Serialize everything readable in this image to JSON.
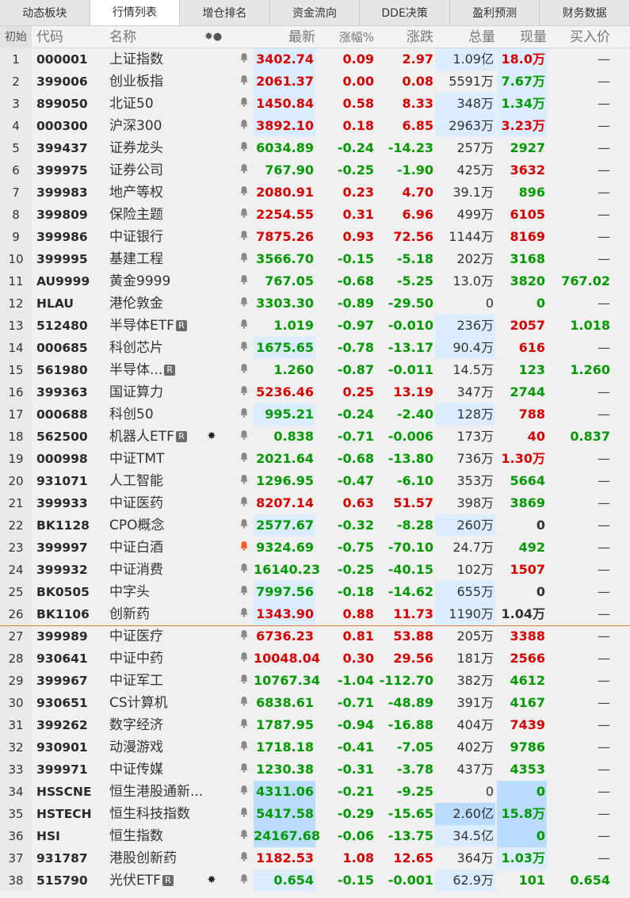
{
  "tabs": [
    "动态板块",
    "行情列表",
    "增仓排名",
    "资金流向",
    "DDE决策",
    "盈利预测",
    "财务数据"
  ],
  "active_tab": 1,
  "header": {
    "idx": "初始",
    "code": "代码",
    "name": "名称",
    "flags": "✸●",
    "last": "最新",
    "pct": "涨幅%",
    "chg": "涨跌",
    "vol": "总量",
    "cur": "现量",
    "bid": "买入价"
  },
  "colors": {
    "up": "#d60000",
    "down": "#009a00",
    "highlight": "#dcecff",
    "highlight_strong": "#b9dcff",
    "separator": "#e07a3a"
  },
  "rows": [
    {
      "i": "1",
      "code": "000001",
      "name": "上证指数",
      "badge": "",
      "flag": "",
      "bell": "off",
      "last": "3402.74",
      "lastHl": "hl1",
      "pct": "0.09",
      "chg": "2.97",
      "vol": "1.09亿",
      "volHl": "hl1",
      "cur": "18.0万",
      "curHl": "hl1",
      "bid": "—",
      "dir": "up",
      "curDir": "up",
      "bidDir": ""
    },
    {
      "i": "2",
      "code": "399006",
      "name": "创业板指",
      "badge": "",
      "flag": "",
      "bell": "off",
      "last": "2061.37",
      "lastHl": "hl1",
      "pct": "0.00",
      "chg": "0.08",
      "vol": "5591万",
      "volHl": "",
      "cur": "7.67万",
      "curHl": "hl1",
      "bid": "—",
      "dir": "up",
      "curDir": "dn",
      "bidDir": ""
    },
    {
      "i": "3",
      "code": "899050",
      "name": "北证50",
      "badge": "",
      "flag": "",
      "bell": "off",
      "last": "1450.84",
      "lastHl": "hl1",
      "pct": "0.58",
      "chg": "8.33",
      "vol": "348万",
      "volHl": "hl1",
      "cur": "1.34万",
      "curHl": "hl1",
      "bid": "—",
      "dir": "up",
      "curDir": "dn",
      "bidDir": ""
    },
    {
      "i": "4",
      "code": "000300",
      "name": "沪深300",
      "badge": "",
      "flag": "",
      "bell": "off",
      "last": "3892.10",
      "lastHl": "hl1",
      "pct": "0.18",
      "chg": "6.85",
      "vol": "2963万",
      "volHl": "hl1",
      "cur": "3.23万",
      "curHl": "hl1",
      "bid": "—",
      "dir": "up",
      "curDir": "up",
      "bidDir": ""
    },
    {
      "i": "5",
      "code": "399437",
      "name": "证券龙头",
      "badge": "",
      "flag": "",
      "bell": "off",
      "last": "6034.89",
      "lastHl": "",
      "pct": "-0.24",
      "chg": "-14.23",
      "vol": "257万",
      "volHl": "",
      "cur": "2927",
      "curHl": "",
      "bid": "—",
      "dir": "dn",
      "curDir": "dn",
      "bidDir": ""
    },
    {
      "i": "6",
      "code": "399975",
      "name": "证券公司",
      "badge": "",
      "flag": "",
      "bell": "off",
      "last": "767.90",
      "lastHl": "",
      "pct": "-0.25",
      "chg": "-1.90",
      "vol": "425万",
      "volHl": "",
      "cur": "3632",
      "curHl": "",
      "bid": "—",
      "dir": "dn",
      "curDir": "up",
      "bidDir": ""
    },
    {
      "i": "7",
      "code": "399983",
      "name": "地产等权",
      "badge": "",
      "flag": "",
      "bell": "off",
      "last": "2080.91",
      "lastHl": "",
      "pct": "0.23",
      "chg": "4.70",
      "vol": "39.1万",
      "volHl": "",
      "cur": "896",
      "curHl": "",
      "bid": "—",
      "dir": "up",
      "curDir": "dn",
      "bidDir": ""
    },
    {
      "i": "8",
      "code": "399809",
      "name": "保险主题",
      "badge": "",
      "flag": "",
      "bell": "off",
      "last": "2254.55",
      "lastHl": "",
      "pct": "0.31",
      "chg": "6.96",
      "vol": "499万",
      "volHl": "",
      "cur": "6105",
      "curHl": "",
      "bid": "—",
      "dir": "up",
      "curDir": "up",
      "bidDir": ""
    },
    {
      "i": "9",
      "code": "399986",
      "name": "中证银行",
      "badge": "",
      "flag": "",
      "bell": "off",
      "last": "7875.26",
      "lastHl": "",
      "pct": "0.93",
      "chg": "72.56",
      "vol": "1144万",
      "volHl": "",
      "cur": "8169",
      "curHl": "",
      "bid": "—",
      "dir": "up",
      "curDir": "up",
      "bidDir": ""
    },
    {
      "i": "10",
      "code": "399995",
      "name": "基建工程",
      "badge": "",
      "flag": "",
      "bell": "off",
      "last": "3566.70",
      "lastHl": "",
      "pct": "-0.15",
      "chg": "-5.18",
      "vol": "202万",
      "volHl": "",
      "cur": "3168",
      "curHl": "",
      "bid": "—",
      "dir": "dn",
      "curDir": "dn",
      "bidDir": ""
    },
    {
      "i": "11",
      "code": "AU9999",
      "name": "黄金9999",
      "badge": "",
      "flag": "",
      "bell": "off",
      "last": "767.05",
      "lastHl": "",
      "pct": "-0.68",
      "chg": "-5.25",
      "vol": "13.0万",
      "volHl": "",
      "cur": "3820",
      "curHl": "",
      "bid": "767.02",
      "dir": "dn",
      "curDir": "dn",
      "bidDir": "dn"
    },
    {
      "i": "12",
      "code": "HLAU",
      "name": "港伦敦金",
      "badge": "",
      "flag": "",
      "bell": "off",
      "last": "3303.30",
      "lastHl": "",
      "pct": "-0.89",
      "chg": "-29.50",
      "vol": "0",
      "volHl": "",
      "cur": "0",
      "curHl": "",
      "bid": "—",
      "dir": "dn",
      "curDir": "dn",
      "bidDir": ""
    },
    {
      "i": "13",
      "code": "512480",
      "name": "半导体ETF",
      "badge": "R",
      "flag": "",
      "bell": "off",
      "last": "1.019",
      "lastHl": "",
      "pct": "-0.97",
      "chg": "-0.010",
      "vol": "236万",
      "volHl": "hl1",
      "cur": "2057",
      "curHl": "",
      "bid": "1.018",
      "dir": "dn",
      "curDir": "up",
      "bidDir": "dn"
    },
    {
      "i": "14",
      "code": "000685",
      "name": "科创芯片",
      "badge": "",
      "flag": "",
      "bell": "off",
      "last": "1675.65",
      "lastHl": "hl1",
      "pct": "-0.78",
      "chg": "-13.17",
      "vol": "90.4万",
      "volHl": "hl1",
      "cur": "616",
      "curHl": "",
      "bid": "—",
      "dir": "dn",
      "curDir": "up",
      "bidDir": ""
    },
    {
      "i": "15",
      "code": "561980",
      "name": "半导体...",
      "badge": "R",
      "flag": "",
      "bell": "off",
      "last": "1.260",
      "lastHl": "",
      "pct": "-0.87",
      "chg": "-0.011",
      "vol": "14.5万",
      "volHl": "",
      "cur": "123",
      "curHl": "",
      "bid": "1.260",
      "dir": "dn",
      "curDir": "dn",
      "bidDir": "dn"
    },
    {
      "i": "16",
      "code": "399363",
      "name": "国证算力",
      "badge": "",
      "flag": "",
      "bell": "off",
      "last": "5236.46",
      "lastHl": "",
      "pct": "0.25",
      "chg": "13.19",
      "vol": "347万",
      "volHl": "",
      "cur": "2744",
      "curHl": "",
      "bid": "—",
      "dir": "up",
      "curDir": "dn",
      "bidDir": ""
    },
    {
      "i": "17",
      "code": "000688",
      "name": "科创50",
      "badge": "",
      "flag": "",
      "bell": "off",
      "last": "995.21",
      "lastHl": "hl1",
      "pct": "-0.24",
      "chg": "-2.40",
      "vol": "128万",
      "volHl": "hl1",
      "cur": "788",
      "curHl": "",
      "bid": "—",
      "dir": "dn",
      "curDir": "up",
      "bidDir": ""
    },
    {
      "i": "18",
      "code": "562500",
      "name": "机器人ETF",
      "badge": "R",
      "flag": "✸",
      "bell": "off",
      "last": "0.838",
      "lastHl": "",
      "pct": "-0.71",
      "chg": "-0.006",
      "vol": "173万",
      "volHl": "",
      "cur": "40",
      "curHl": "",
      "bid": "0.837",
      "dir": "dn",
      "curDir": "up",
      "bidDir": "dn"
    },
    {
      "i": "19",
      "code": "000998",
      "name": "中证TMT",
      "badge": "",
      "flag": "",
      "bell": "off",
      "last": "2021.64",
      "lastHl": "",
      "pct": "-0.68",
      "chg": "-13.80",
      "vol": "736万",
      "volHl": "",
      "cur": "1.30万",
      "curHl": "",
      "bid": "—",
      "dir": "dn",
      "curDir": "up",
      "bidDir": ""
    },
    {
      "i": "20",
      "code": "931071",
      "name": "人工智能",
      "badge": "",
      "flag": "",
      "bell": "off",
      "last": "1296.95",
      "lastHl": "",
      "pct": "-0.47",
      "chg": "-6.10",
      "vol": "353万",
      "volHl": "",
      "cur": "5664",
      "curHl": "",
      "bid": "—",
      "dir": "dn",
      "curDir": "dn",
      "bidDir": ""
    },
    {
      "i": "21",
      "code": "399933",
      "name": "中证医药",
      "badge": "",
      "flag": "",
      "bell": "off",
      "last": "8207.14",
      "lastHl": "",
      "pct": "0.63",
      "chg": "51.57",
      "vol": "398万",
      "volHl": "",
      "cur": "3869",
      "curHl": "",
      "bid": "—",
      "dir": "up",
      "curDir": "dn",
      "bidDir": ""
    },
    {
      "i": "22",
      "code": "BK1128",
      "name": "CPO概念",
      "badge": "",
      "flag": "",
      "bell": "off",
      "last": "2577.67",
      "lastHl": "hl1",
      "pct": "-0.32",
      "chg": "-8.28",
      "vol": "260万",
      "volHl": "hl1",
      "cur": "0",
      "curHl": "",
      "bid": "—",
      "dir": "dn",
      "curDir": "zr",
      "bidDir": ""
    },
    {
      "i": "23",
      "code": "399997",
      "name": "中证白酒",
      "badge": "",
      "flag": "",
      "bell": "on",
      "last": "9324.69",
      "lastHl": "",
      "pct": "-0.75",
      "chg": "-70.10",
      "vol": "24.7万",
      "volHl": "",
      "cur": "492",
      "curHl": "",
      "bid": "—",
      "dir": "dn",
      "curDir": "dn",
      "bidDir": ""
    },
    {
      "i": "24",
      "code": "399932",
      "name": "中证消费",
      "badge": "",
      "flag": "",
      "bell": "off",
      "last": "16140.23",
      "lastHl": "",
      "pct": "-0.25",
      "chg": "-40.15",
      "vol": "102万",
      "volHl": "",
      "cur": "1507",
      "curHl": "",
      "bid": "—",
      "dir": "dn",
      "curDir": "up",
      "bidDir": ""
    },
    {
      "i": "25",
      "code": "BK0505",
      "name": "中字头",
      "badge": "",
      "flag": "",
      "bell": "off",
      "last": "7997.56",
      "lastHl": "hl1",
      "pct": "-0.18",
      "chg": "-14.62",
      "vol": "655万",
      "volHl": "hl1",
      "cur": "0",
      "curHl": "",
      "bid": "—",
      "dir": "dn",
      "curDir": "zr",
      "bidDir": ""
    },
    {
      "i": "26",
      "code": "BK1106",
      "name": "创新药",
      "badge": "",
      "flag": "",
      "bell": "off",
      "last": "1343.90",
      "lastHl": "hl1",
      "pct": "0.88",
      "chg": "11.73",
      "vol": "1190万",
      "volHl": "hl1",
      "cur": "1.04万",
      "curHl": "",
      "bid": "—",
      "dir": "up",
      "curDir": "zr",
      "bidDir": ""
    },
    {
      "i": "27",
      "code": "399989",
      "name": "中证医疗",
      "badge": "",
      "flag": "",
      "bell": "off",
      "last": "6736.23",
      "lastHl": "",
      "pct": "0.81",
      "chg": "53.88",
      "vol": "205万",
      "volHl": "",
      "cur": "3388",
      "curHl": "",
      "bid": "—",
      "dir": "up",
      "curDir": "up",
      "bidDir": ""
    },
    {
      "i": "28",
      "code": "930641",
      "name": "中证中药",
      "badge": "",
      "flag": "",
      "bell": "off",
      "last": "10048.04",
      "lastHl": "",
      "pct": "0.30",
      "chg": "29.56",
      "vol": "181万",
      "volHl": "",
      "cur": "2566",
      "curHl": "",
      "bid": "—",
      "dir": "up",
      "curDir": "up",
      "bidDir": ""
    },
    {
      "i": "29",
      "code": "399967",
      "name": "中证军工",
      "badge": "",
      "flag": "",
      "bell": "off",
      "last": "10767.34",
      "lastHl": "",
      "pct": "-1.04",
      "chg": "-112.70",
      "vol": "382万",
      "volHl": "",
      "cur": "4612",
      "curHl": "",
      "bid": "—",
      "dir": "dn",
      "curDir": "dn",
      "bidDir": ""
    },
    {
      "i": "30",
      "code": "930651",
      "name": "CS计算机",
      "badge": "",
      "flag": "",
      "bell": "off",
      "last": "6838.61",
      "lastHl": "",
      "pct": "-0.71",
      "chg": "-48.89",
      "vol": "391万",
      "volHl": "",
      "cur": "4167",
      "curHl": "",
      "bid": "—",
      "dir": "dn",
      "curDir": "dn",
      "bidDir": ""
    },
    {
      "i": "31",
      "code": "399262",
      "name": "数字经济",
      "badge": "",
      "flag": "",
      "bell": "off",
      "last": "1787.95",
      "lastHl": "",
      "pct": "-0.94",
      "chg": "-16.88",
      "vol": "404万",
      "volHl": "",
      "cur": "7439",
      "curHl": "",
      "bid": "—",
      "dir": "dn",
      "curDir": "up",
      "bidDir": ""
    },
    {
      "i": "32",
      "code": "930901",
      "name": "动漫游戏",
      "badge": "",
      "flag": "",
      "bell": "off",
      "last": "1718.18",
      "lastHl": "",
      "pct": "-0.41",
      "chg": "-7.05",
      "vol": "402万",
      "volHl": "",
      "cur": "9786",
      "curHl": "",
      "bid": "—",
      "dir": "dn",
      "curDir": "dn",
      "bidDir": ""
    },
    {
      "i": "33",
      "code": "399971",
      "name": "中证传媒",
      "badge": "",
      "flag": "",
      "bell": "off",
      "last": "1230.38",
      "lastHl": "",
      "pct": "-0.31",
      "chg": "-3.78",
      "vol": "437万",
      "volHl": "",
      "cur": "4353",
      "curHl": "",
      "bid": "—",
      "dir": "dn",
      "curDir": "dn",
      "bidDir": ""
    },
    {
      "i": "34",
      "code": "HSSCNE",
      "name": "恒生港股通新...",
      "badge": "",
      "flag": "",
      "bell": "off",
      "last": "4311.06",
      "lastHl": "hl2",
      "pct": "-0.21",
      "chg": "-9.25",
      "vol": "0",
      "volHl": "",
      "cur": "0",
      "curHl": "hl2",
      "bid": "—",
      "dir": "dn",
      "curDir": "dn",
      "bidDir": ""
    },
    {
      "i": "35",
      "code": "HSTECH",
      "name": "恒生科技指数",
      "badge": "",
      "flag": "",
      "bell": "off",
      "last": "5417.58",
      "lastHl": "hl2",
      "pct": "-0.29",
      "chg": "-15.65",
      "vol": "2.60亿",
      "volHl": "hl2",
      "cur": "15.8万",
      "curHl": "hl2",
      "bid": "—",
      "dir": "dn",
      "curDir": "dn",
      "bidDir": ""
    },
    {
      "i": "36",
      "code": "HSI",
      "name": "恒生指数",
      "badge": "",
      "flag": "",
      "bell": "off",
      "last": "24167.68",
      "lastHl": "hl2",
      "pct": "-0.06",
      "chg": "-13.75",
      "vol": "34.5亿",
      "volHl": "hl1",
      "cur": "0",
      "curHl": "hl2",
      "bid": "—",
      "dir": "dn",
      "curDir": "dn",
      "bidDir": ""
    },
    {
      "i": "37",
      "code": "931787",
      "name": "港股创新药",
      "badge": "",
      "flag": "",
      "bell": "off",
      "last": "1182.53",
      "lastHl": "",
      "pct": "1.08",
      "chg": "12.65",
      "vol": "364万",
      "volHl": "",
      "cur": "1.03万",
      "curHl": "hl1",
      "bid": "—",
      "dir": "up",
      "curDir": "dn",
      "bidDir": ""
    },
    {
      "i": "38",
      "code": "515790",
      "name": "光伏ETF",
      "badge": "R",
      "flag": "✸",
      "bell": "off",
      "last": "0.654",
      "lastHl": "hl1",
      "pct": "-0.15",
      "chg": "-0.001",
      "vol": "62.9万",
      "volHl": "hl1",
      "cur": "101",
      "curHl": "",
      "bid": "0.654",
      "dir": "dn",
      "curDir": "dn",
      "bidDir": "dn"
    }
  ]
}
